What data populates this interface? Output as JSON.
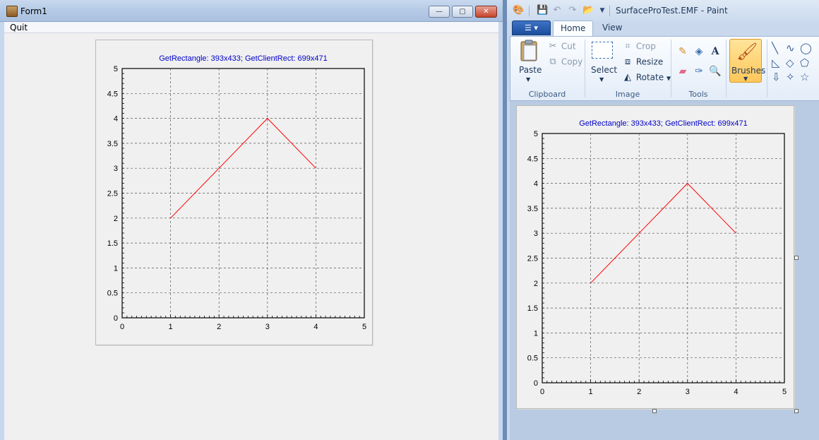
{
  "form1": {
    "title": "Form1",
    "menu": {
      "quit": "Quit"
    },
    "controls": {
      "minimize": "—",
      "maximize": "▢",
      "close": "✕"
    }
  },
  "paint": {
    "title": "SurfaceProTest.EMF - Paint",
    "tabs": [
      "Home",
      "View"
    ],
    "ribbon": {
      "clipboard": {
        "label": "Clipboard",
        "paste": "Paste",
        "cut": "Cut",
        "copy": "Copy"
      },
      "image": {
        "label": "Image",
        "select": "Select",
        "crop": "Crop",
        "resize": "Resize",
        "rotate": "Rotate"
      },
      "tools": {
        "label": "Tools"
      },
      "brushes": "Brushes"
    }
  },
  "icons": [
    "app-icon",
    "save-icon",
    "undo-icon",
    "redo-icon",
    "paste-icon",
    "cut-icon",
    "copy-icon",
    "select-icon",
    "crop-icon",
    "resize-icon",
    "rotate-icon",
    "pencil-icon",
    "fill-icon",
    "text-icon",
    "eraser-icon",
    "color-picker-icon",
    "magnifier-icon",
    "brush-icon",
    "line-icon",
    "curve-icon",
    "oval-icon",
    "rectangle-icon"
  ],
  "colors": {
    "line": "#ff0000",
    "title_text": "#0000c8",
    "grid": "#555555"
  },
  "chart_data": [
    {
      "type": "line",
      "title": "GetRectangle: 393x433; GetClientRect: 699x471",
      "xlabel": "",
      "ylabel": "",
      "xlim": [
        0,
        5
      ],
      "ylim": [
        0,
        5
      ],
      "x_ticks": [
        "0",
        "1",
        "2",
        "3",
        "4",
        "5"
      ],
      "y_ticks": [
        "0",
        "0.5",
        "1",
        "1.5",
        "2",
        "2.5",
        "3",
        "3.5",
        "4",
        "4.5",
        "5"
      ],
      "grid": true,
      "series": [
        {
          "x": [
            1,
            2,
            3,
            4
          ],
          "y": [
            2,
            3,
            4,
            3
          ]
        }
      ]
    },
    {
      "type": "line",
      "title": "GetRectangle: 393x433; GetClientRect: 699x471",
      "xlabel": "",
      "ylabel": "",
      "xlim": [
        0,
        5
      ],
      "ylim": [
        0,
        5
      ],
      "x_ticks": [
        "0",
        "1",
        "2",
        "3",
        "4",
        "5"
      ],
      "y_ticks": [
        "0",
        "0.5",
        "1",
        "1.5",
        "2",
        "2.5",
        "3",
        "3.5",
        "4",
        "4.5",
        "5"
      ],
      "grid": true,
      "series": [
        {
          "x": [
            1,
            2,
            3,
            4
          ],
          "y": [
            2,
            3,
            4,
            3
          ]
        }
      ]
    }
  ]
}
